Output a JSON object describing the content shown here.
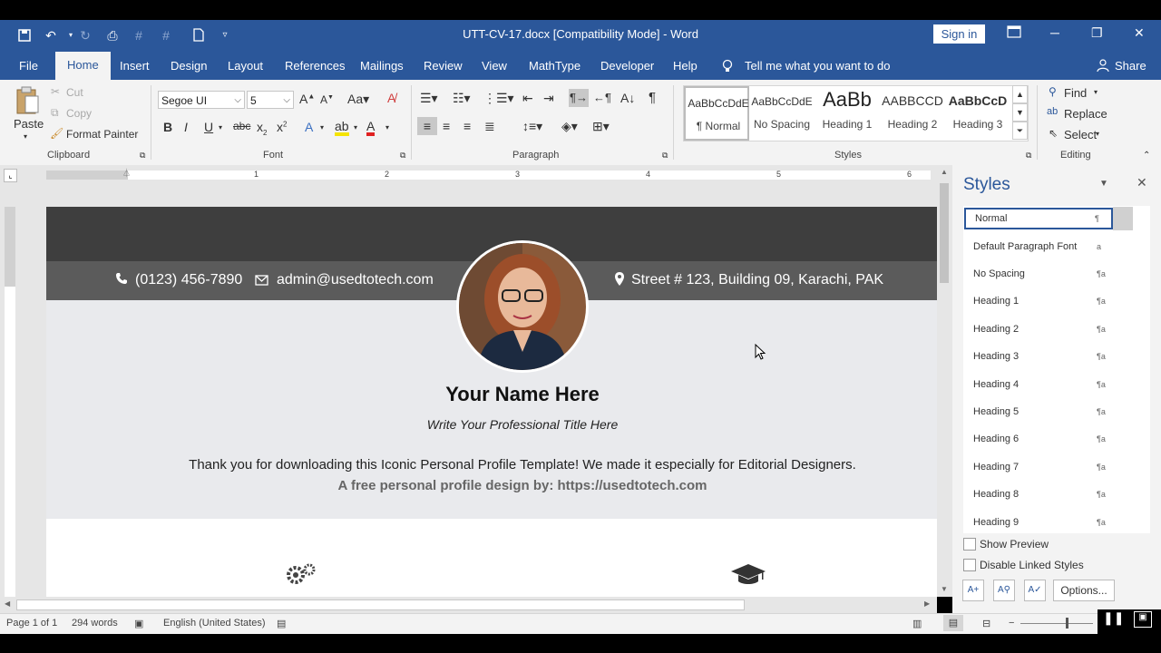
{
  "window": {
    "title": "UTT-CV-17.docx [Compatibility Mode]  -  Word",
    "sign_in": "Sign in"
  },
  "tabs": [
    "File",
    "Home",
    "Insert",
    "Design",
    "Layout",
    "References",
    "Mailings",
    "Review",
    "View",
    "MathType",
    "Developer",
    "Help"
  ],
  "tell_me": "Tell me what you want to do",
  "share": "Share",
  "clipboard": {
    "paste": "Paste",
    "cut": "Cut",
    "copy": "Copy",
    "format_painter": "Format Painter",
    "label": "Clipboard"
  },
  "font": {
    "name": "Segoe UI",
    "size": "5",
    "label": "Font"
  },
  "paragraph": {
    "label": "Paragraph"
  },
  "styles_group": {
    "label": "Styles",
    "items": [
      {
        "preview": "AaBbCcDdE",
        "name": "¶ Normal"
      },
      {
        "preview": "AaBbCcDdE",
        "name": "No Spacing"
      },
      {
        "preview": "AaBb",
        "name": "Heading 1"
      },
      {
        "preview": "AABBCCD",
        "name": "Heading 2"
      },
      {
        "preview": "AaBbCcD",
        "name": "Heading 3"
      }
    ]
  },
  "editing": {
    "find": "Find",
    "replace": "Replace",
    "select": "Select",
    "label": "Editing"
  },
  "ruler": [
    "1",
    "2",
    "3",
    "4",
    "5",
    "6"
  ],
  "document": {
    "phone": "(0123) 456-7890",
    "email": "admin@usedtotech.com",
    "address": "Street # 123, Building 09, Karachi, PAK",
    "name": "Your Name Here",
    "title": "Write Your Professional Title Here",
    "thanks": "Thank you for downloading this Iconic Personal Profile Template! We made it especially for Editorial Designers.",
    "credit": "A free personal profile design by: https://usedtotech.com"
  },
  "styles_pane": {
    "title": "Styles",
    "items": [
      {
        "name": "Normal",
        "mark": "¶"
      },
      {
        "name": "Default Paragraph Font",
        "mark": "a"
      },
      {
        "name": "No Spacing",
        "mark": "¶a"
      },
      {
        "name": "Heading 1",
        "mark": "¶a"
      },
      {
        "name": "Heading 2",
        "mark": "¶a"
      },
      {
        "name": "Heading 3",
        "mark": "¶a"
      },
      {
        "name": "Heading 4",
        "mark": "¶a"
      },
      {
        "name": "Heading 5",
        "mark": "¶a"
      },
      {
        "name": "Heading 6",
        "mark": "¶a"
      },
      {
        "name": "Heading 7",
        "mark": "¶a"
      },
      {
        "name": "Heading 8",
        "mark": "¶a"
      },
      {
        "name": "Heading 9",
        "mark": "¶a"
      }
    ],
    "show_preview": "Show Preview",
    "disable_linked": "Disable Linked Styles",
    "options": "Options..."
  },
  "status": {
    "page": "Page 1 of 1",
    "words": "294 words",
    "language": "English (United States)"
  },
  "colors": {
    "word_blue": "#2b579a",
    "contact_band": "#5b5b5b",
    "top_band": "#3e3e3e",
    "body_band": "#e9eaed"
  }
}
